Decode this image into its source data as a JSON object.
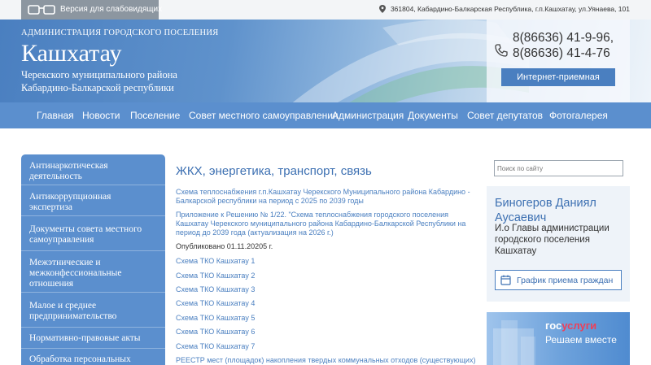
{
  "topbar": {
    "vision_label": "Версия для слабовидящих",
    "address": "361804, Кабардино-Балкарская Республика, г.п.Кашхатау, ул.Уянаева, 101"
  },
  "header": {
    "admin_label": "АДМИНИСТРАЦИЯ ГОРОДСКОГО ПОСЕЛЕНИЯ",
    "title": "Кашхатау",
    "subtitle_line1": "Черекского муниципального района",
    "subtitle_line2": "Кабардино-Балкарской республики",
    "phone1": "8(86636) 41-9-96,",
    "phone2": "8(86636) 41-4-76",
    "reception_label": "Интернет-приемная"
  },
  "nav": {
    "items": [
      "Главная",
      "Новости",
      "Поселение",
      "Совет местного самоуправления",
      "Администрация",
      "Документы",
      "Совет депутатов",
      "Фотогалерея"
    ]
  },
  "sidebar": {
    "items": [
      {
        "line1": "Антинаркотическая",
        "line2": "деятельность"
      },
      {
        "line1": "Антикоррупционная",
        "line2": "экспертиза"
      },
      {
        "line1": "Документы совета местного",
        "line2": "самоуправления"
      },
      {
        "line1": "Межэтнические и",
        "line2": "межконфессиональные",
        "line3": "отношения"
      },
      {
        "line1": "Малое и среднее",
        "line2": "предпринимательство"
      },
      {
        "line1": "Нормативно-правовые акты"
      },
      {
        "line1": "Обработка персональных"
      }
    ]
  },
  "main": {
    "title": "ЖКХ, энергетика, транспорт, связь",
    "link1_line1": "Схема теплоснабжения г.п.Кашхатау Черекского Муниципального района Кабардино -",
    "link1_line2": "Балкарской республики на период с 2025 по 2039 годы",
    "link2_line1": "Приложение к Решению № 1/22. \"Схема теплоснабжения городского поселения",
    "link2_line2": "Кашхатау Черекского муниципального района Кабардино-Балкарской Республики на",
    "link2_line3": "период до 2039 года (актуализация на 2026 г.)",
    "published": "Опубликовано 01.11.20205 г.",
    "tko_links": [
      "Схема ТКО Кашхатау 1",
      "Схема ТКО Кашхатау 2",
      "Схема ТКО Кашхатау 3",
      "Схема ТКО Кашхатау 4",
      "Схема ТКО Кашхатау 5",
      "Схема ТКО Кашхатау 6",
      "Схема ТКО Кашхатау 7"
    ],
    "registry_link": "РЕЕСТР мест (площадок) накопления твердых коммунальных отходов (существующих)"
  },
  "right": {
    "search_placeholder": "Поиск по сайту",
    "head_name_line1": "Биногеров Даниял",
    "head_name_line2": "Аусаевич",
    "head_position_lines": [
      "И.о Главы администрации",
      "городского поселения",
      "Кашхатау"
    ],
    "schedule_label": "График приема граждан",
    "gos_logo_part1": "гос",
    "gos_logo_part2": "услуги",
    "gos_slogan": "Решаем вместе"
  },
  "colors": {
    "nav_blue": "#5b8fce",
    "link_blue": "#4a7fc0",
    "title_blue": "#3d70b2"
  }
}
